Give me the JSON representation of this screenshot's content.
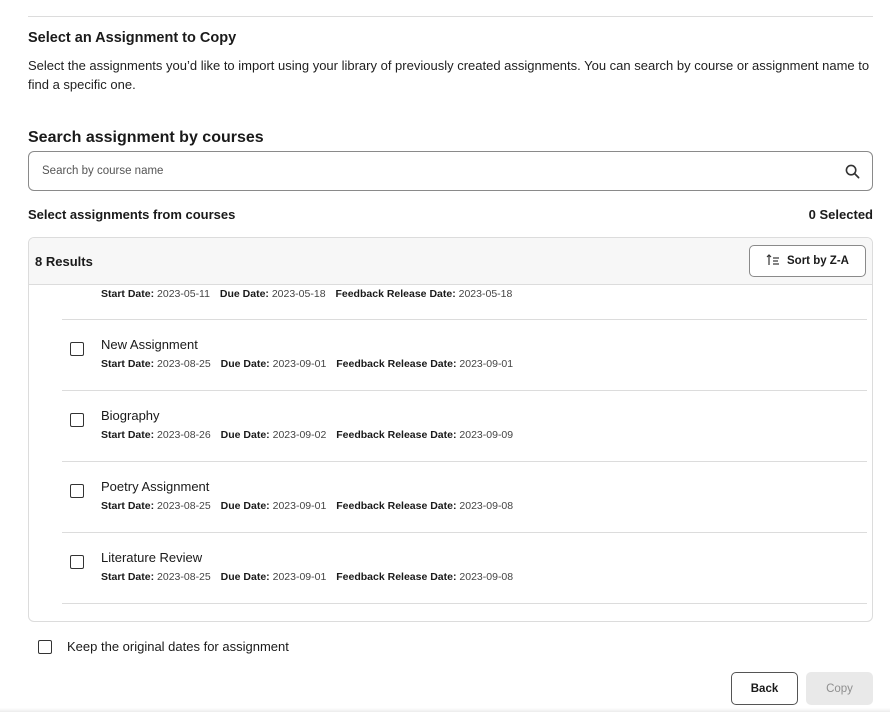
{
  "section": {
    "title": "Select an Assignment to Copy",
    "description": "Select the assignments you’d like to import using your library of previously created assignments. You can search by course or assignment name to find a specific one."
  },
  "search": {
    "title": "Search assignment by courses",
    "placeholder": "Search by course name",
    "icon": "search-icon"
  },
  "selection": {
    "label": "Select assignments from courses",
    "count": "0 Selected"
  },
  "results": {
    "count_label": "8 Results",
    "sort_label": "Sort by Z-A",
    "sort_icon": "sort-descending-icon",
    "date_labels": {
      "start": "Start Date:",
      "due": "Due Date:",
      "feedback": "Feedback Release Date:"
    },
    "items": [
      {
        "name": "",
        "start": "2023-05-11",
        "due": "2023-05-18",
        "feedback": "2023-05-18",
        "checked": false
      },
      {
        "name": "New Assignment",
        "start": "2023-08-25",
        "due": "2023-09-01",
        "feedback": "2023-09-01",
        "checked": false
      },
      {
        "name": "Biography",
        "start": "2023-08-26",
        "due": "2023-09-02",
        "feedback": "2023-09-09",
        "checked": false
      },
      {
        "name": "Poetry Assignment",
        "start": "2023-08-25",
        "due": "2023-09-01",
        "feedback": "2023-09-08",
        "checked": false
      },
      {
        "name": "Literature Review",
        "start": "2023-08-25",
        "due": "2023-09-01",
        "feedback": "2023-09-08",
        "checked": false
      }
    ]
  },
  "options": {
    "keep_dates_label": "Keep the original dates for assignment",
    "keep_dates_checked": false
  },
  "actions": {
    "back_label": "Back",
    "copy_label": "Copy",
    "copy_disabled": true
  }
}
